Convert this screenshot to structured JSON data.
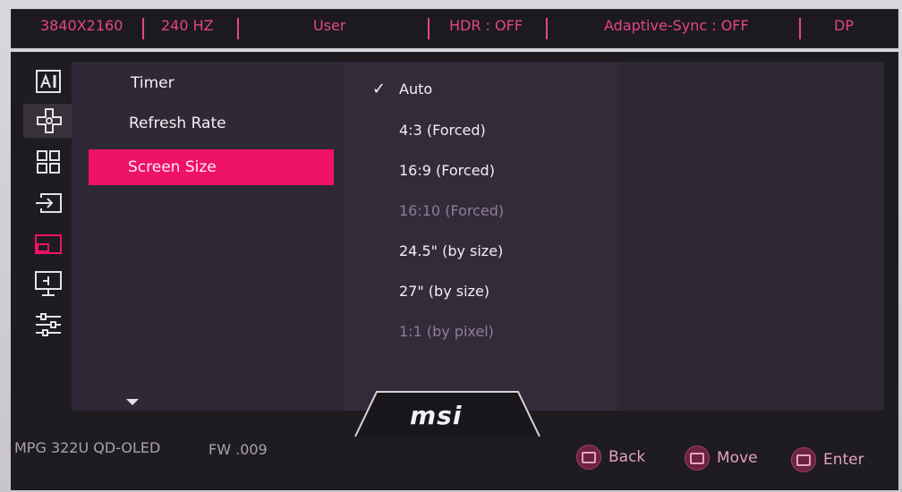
{
  "status_bar": {
    "resolution": "3840X2160",
    "refresh": "240 HZ",
    "profile": "User",
    "hdr": "HDR : OFF",
    "adaptive_sync": "Adaptive-Sync : OFF",
    "input": "DP"
  },
  "nav_icons": [
    "ai-icon",
    "gamepad-icon",
    "grid-icon",
    "input-source-icon",
    "pip-icon",
    "display-icon",
    "settings-sliders-icon"
  ],
  "menu": {
    "items": [
      {
        "label": "Timer"
      },
      {
        "label": "Refresh Rate"
      },
      {
        "label": "Screen Size"
      }
    ]
  },
  "options": {
    "items": [
      {
        "label": "Auto",
        "checked": true,
        "enabled": true
      },
      {
        "label": "4:3 (Forced)",
        "enabled": true
      },
      {
        "label": "16:9 (Forced)",
        "enabled": true
      },
      {
        "label": "16:10 (Forced)",
        "enabled": false
      },
      {
        "label": "24.5\" (by size)",
        "enabled": true
      },
      {
        "label": "27\" (by size)",
        "enabled": true
      },
      {
        "label": "1:1 (by pixel)",
        "enabled": false
      }
    ],
    "check_glyph": "✓"
  },
  "footer": {
    "model": "MPG 322U QD-OLED",
    "firmware": "FW .009",
    "brand": "msi",
    "hints": [
      {
        "label": "Back",
        "icon": "back-joystick-icon"
      },
      {
        "label": "Move",
        "icon": "move-joystick-icon"
      },
      {
        "label": "Enter",
        "icon": "enter-joystick-icon"
      }
    ]
  },
  "colors": {
    "accent": "#ef1269",
    "status_text": "#e2468a",
    "panel": "#1e1b21"
  }
}
